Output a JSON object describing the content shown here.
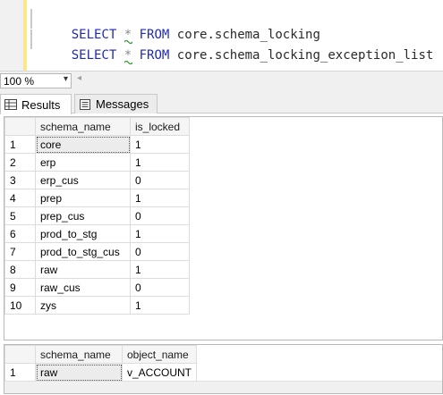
{
  "editor": {
    "lines": [
      {
        "keyword1": "SELECT",
        "star": "*",
        "keyword2": "FROM",
        "object": "core.schema_locking"
      },
      {
        "keyword1": "SELECT",
        "star": "*",
        "keyword2": "FROM",
        "object": "core.schema_locking_exception_list"
      }
    ]
  },
  "zoom": {
    "value": "100 %",
    "dropdown_glyph": "▾",
    "scroll_glyph": "◂"
  },
  "tabs": [
    {
      "label": "Results",
      "icon": "grid-icon",
      "active": true
    },
    {
      "label": "Messages",
      "icon": "messages-icon",
      "active": false
    }
  ],
  "results": [
    {
      "columns": [
        "schema_name",
        "is_locked"
      ],
      "rows": [
        {
          "n": "1",
          "c": [
            "core",
            "1"
          ]
        },
        {
          "n": "2",
          "c": [
            "erp",
            "1"
          ]
        },
        {
          "n": "3",
          "c": [
            "erp_cus",
            "0"
          ]
        },
        {
          "n": "4",
          "c": [
            "prep",
            "1"
          ]
        },
        {
          "n": "5",
          "c": [
            "prep_cus",
            "0"
          ]
        },
        {
          "n": "6",
          "c": [
            "prod_to_stg",
            "1"
          ]
        },
        {
          "n": "7",
          "c": [
            "prod_to_stg_cus",
            "0"
          ]
        },
        {
          "n": "8",
          "c": [
            "raw",
            "1"
          ]
        },
        {
          "n": "9",
          "c": [
            "raw_cus",
            "0"
          ]
        },
        {
          "n": "10",
          "c": [
            "zys",
            "1"
          ]
        }
      ]
    },
    {
      "columns": [
        "schema_name",
        "object_name"
      ],
      "rows": [
        {
          "n": "1",
          "c": [
            "raw",
            "v_ACCOUNT"
          ]
        }
      ]
    }
  ],
  "colors": {
    "keyword": "#1f2ab5",
    "changebar": "#f9e98a",
    "selected_cell": "#ececec"
  }
}
